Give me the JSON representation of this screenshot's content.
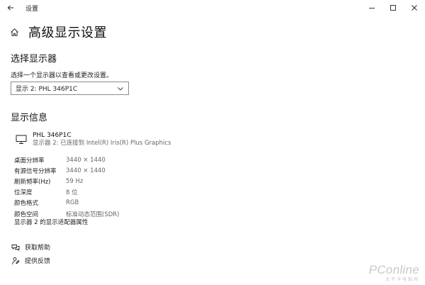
{
  "window": {
    "title": "设置"
  },
  "header": {
    "title": "高级显示设置"
  },
  "select_display": {
    "section_title": "选择显示器",
    "description": "选择一个显示器以查看或更改设置。",
    "selected": "显示 2: PHL 346P1C"
  },
  "display_info": {
    "section_title": "显示信息",
    "monitor_name": "PHL 346P1C",
    "monitor_sub": "显示器 2: 已连接到 Intel(R) Iris(R) Plus Graphics",
    "rows": [
      {
        "label": "桌面分辨率",
        "value": "3440 × 1440"
      },
      {
        "label": "有源信号分辨率",
        "value": "3440 × 1440"
      },
      {
        "label": "刷新频率(Hz)",
        "value": "59 Hz"
      },
      {
        "label": "位深度",
        "value": "8 位"
      },
      {
        "label": "颜色格式",
        "value": "RGB"
      },
      {
        "label": "颜色空间",
        "value": "标准动态范围(SDR)"
      }
    ],
    "adapter_link": "显示器 2 的显示适配器属性"
  },
  "help": {
    "get_help": "获取帮助",
    "feedback": "提供反馈"
  },
  "watermark": {
    "main": "PConline",
    "sub": "太平洋电脑网"
  },
  "icons": {
    "back": "back-arrow-icon",
    "minimize": "minimize-icon",
    "maximize": "maximize-icon",
    "close": "close-icon",
    "home": "home-icon",
    "chevron": "chevron-down-icon",
    "monitor": "monitor-icon",
    "help": "help-chat-icon",
    "feedback": "feedback-person-icon"
  }
}
